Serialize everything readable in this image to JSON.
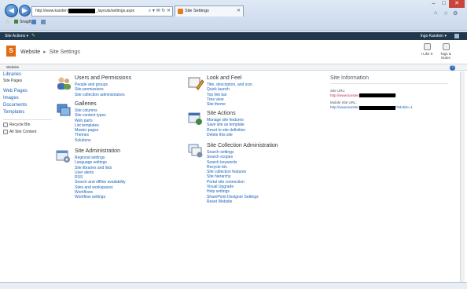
{
  "browser": {
    "address_prefix": "http://www.karsten",
    "address_suffix": "_layouts/settings.aspx",
    "address_actions": "⌕ ▾ ✉ ↻ ✕",
    "tab_title": "Site Settings",
    "fav_label": "SnagIt",
    "win_min": "–",
    "win_max": "□",
    "win_close": "✕",
    "icons": [
      "home-icon",
      "star-icon",
      "gear-icon"
    ],
    "home_glyph": "⌂",
    "star_glyph": "☆",
    "gear_glyph": "⚙"
  },
  "ribbon": {
    "site_actions": "Site Actions ▾",
    "edit_glyph": "✎",
    "user": "Ingo Karstein ▾"
  },
  "title": {
    "logo": "S",
    "breadcrumb_site": "Website",
    "breadcrumb_sep": "▸",
    "breadcrumb_current": "Site Settings",
    "like_label": "I Like It",
    "tags_label": "Tags & Notes",
    "website_tab": "Website",
    "help_glyph": "?"
  },
  "leftnav": {
    "libraries": "Libraries",
    "site_pages": "Site Pages",
    "links": [
      "Web Pages",
      "Images",
      "Documents",
      "Templates"
    ],
    "recycle_bin": "Recycle Bin",
    "all_content": "All Site Content"
  },
  "sections": {
    "users": {
      "heading": "Users and Permissions",
      "links": [
        "People and groups",
        "Site permissions",
        "Site collection administrators"
      ]
    },
    "galleries": {
      "heading": "Galleries",
      "links": [
        "Site columns",
        "Site content types",
        "Web parts",
        "List templates",
        "Master pages",
        "Themes",
        "Solutions"
      ]
    },
    "site_admin": {
      "heading": "Site Administration",
      "links": [
        "Regional settings",
        "Language settings",
        "Site libraries and lists",
        "User alerts",
        "RSS",
        "Search and offline availability",
        "Sites and workspaces",
        "Workflows",
        "Workflow settings"
      ]
    },
    "look_feel": {
      "heading": "Look and Feel",
      "links": [
        "Title, description, and icon",
        "Quick launch",
        "Top link bar",
        "Tree view",
        "Site theme"
      ]
    },
    "site_actions": {
      "heading": "Site Actions",
      "links": [
        "Manage site features",
        "Save site as template",
        "Reset to site definition",
        "Delete this site"
      ]
    },
    "collection_admin": {
      "heading": "Site Collection Administration",
      "links": [
        "Search settings",
        "Search scopes",
        "Search keywords",
        "Recycle bin",
        "Site collection features",
        "Site hierarchy",
        "Portal site connection",
        "Visual Upgrade",
        "Help settings",
        "SharePoint Designer Settings",
        "Reset Website"
      ]
    }
  },
  "siteinfo": {
    "heading": "Site Information",
    "site_url_label": "Site URL:",
    "site_url_prefix": "http://www.karsten",
    "site_url_suffix": "/",
    "mobile_url_label": "Mobile Site URL:",
    "mobile_url_prefix": "http://www.karsten",
    "mobile_url_suffix": "/?Mobile=1"
  },
  "colors": {
    "link": "#1b62b8",
    "ribbon": "#21374c",
    "logo": "#e06b14",
    "site_url": "#c0306a"
  }
}
